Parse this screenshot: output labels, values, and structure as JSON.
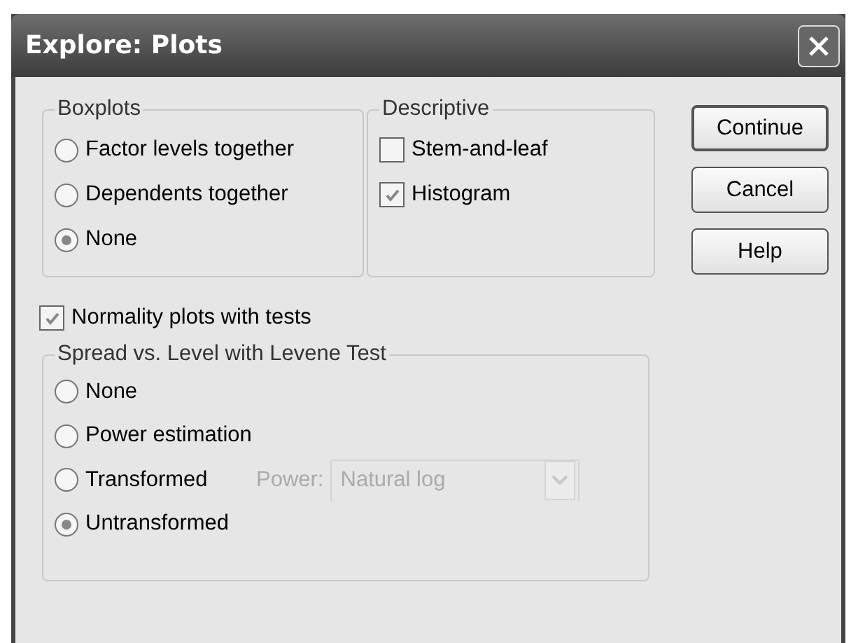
{
  "window": {
    "title": "Explore: Plots"
  },
  "boxplots": {
    "label": "Boxplots",
    "options": [
      {
        "label": "Factor levels together",
        "selected": false
      },
      {
        "label": "Dependents together",
        "selected": false
      },
      {
        "label": "None",
        "selected": true
      }
    ]
  },
  "descriptive": {
    "label": "Descriptive",
    "options": [
      {
        "label": "Stem-and-leaf",
        "checked": false
      },
      {
        "label": "Histogram",
        "checked": true
      }
    ]
  },
  "buttons": [
    {
      "label": "Continue",
      "default": true
    },
    {
      "label": "Cancel",
      "default": false
    },
    {
      "label": "Help",
      "default": false
    }
  ],
  "normality": {
    "label": "Normality plots with tests",
    "checked": true
  },
  "spread": {
    "label": "Spread vs. Level with Levene Test",
    "options": [
      {
        "label": "None",
        "selected": false
      },
      {
        "label": "Power estimation",
        "selected": false
      },
      {
        "label": "Transformed",
        "selected": false
      },
      {
        "label": "Untransformed",
        "selected": true
      }
    ],
    "power": {
      "label": "Power:",
      "value": "Natural log",
      "disabled": true
    }
  }
}
